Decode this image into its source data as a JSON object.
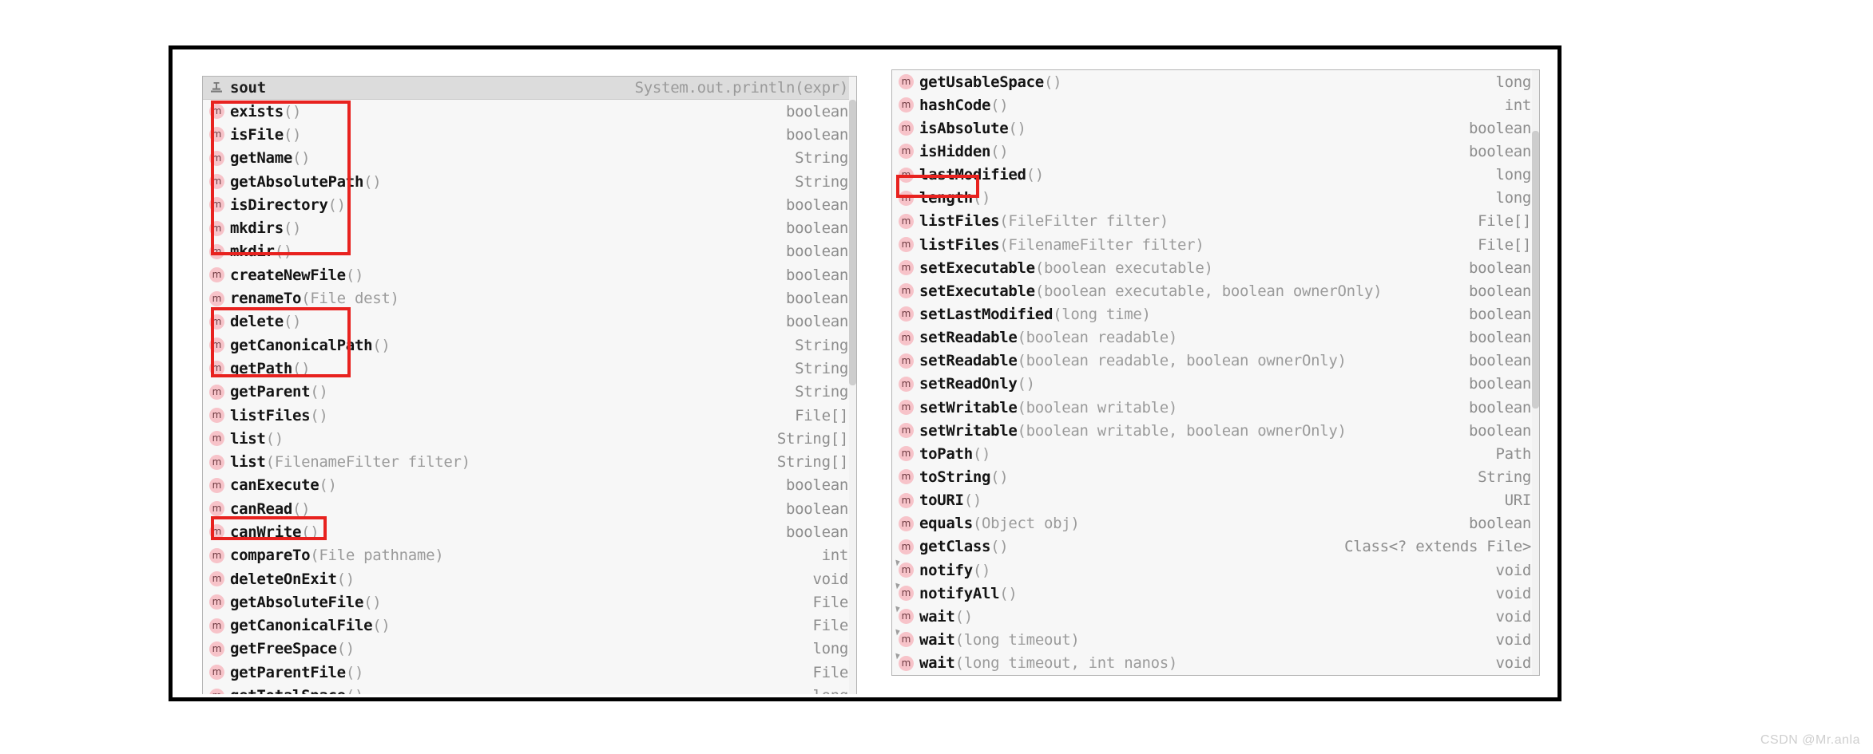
{
  "watermark": "CSDN @Mr.anla",
  "left_popup": {
    "template_header": {
      "icon": "live-template-stamp-icon",
      "name": "sout",
      "expansion": "System.out.println(expr)"
    },
    "scrollbar": {
      "present": true,
      "thumb_top_pct": 0,
      "thumb_height_pct": 48
    },
    "items": [
      {
        "icon": "method-icon",
        "name": "exists",
        "params": "()",
        "type": "boolean"
      },
      {
        "icon": "method-icon",
        "name": "isFile",
        "params": "()",
        "type": "boolean"
      },
      {
        "icon": "method-icon",
        "name": "getName",
        "params": "()",
        "type": "String"
      },
      {
        "icon": "method-icon",
        "name": "getAbsolutePath",
        "params": "()",
        "type": "String"
      },
      {
        "icon": "method-icon",
        "name": "isDirectory",
        "params": "()",
        "type": "boolean"
      },
      {
        "icon": "method-icon",
        "name": "mkdirs",
        "params": "()",
        "type": "boolean"
      },
      {
        "icon": "method-icon",
        "name": "mkdir",
        "params": "()",
        "type": "boolean"
      },
      {
        "icon": "method-icon",
        "name": "createNewFile",
        "params": "()",
        "type": "boolean"
      },
      {
        "icon": "method-icon",
        "name": "renameTo",
        "params": "(File dest)",
        "type": "boolean"
      },
      {
        "icon": "method-icon",
        "name": "delete",
        "params": "()",
        "type": "boolean"
      },
      {
        "icon": "method-icon",
        "name": "getCanonicalPath",
        "params": "()",
        "type": "String"
      },
      {
        "icon": "method-icon",
        "name": "getPath",
        "params": "()",
        "type": "String"
      },
      {
        "icon": "method-icon",
        "name": "getParent",
        "params": "()",
        "type": "String"
      },
      {
        "icon": "method-icon",
        "name": "listFiles",
        "params": "()",
        "type": "File[]"
      },
      {
        "icon": "method-icon",
        "name": "list",
        "params": "()",
        "type": "String[]"
      },
      {
        "icon": "method-icon",
        "name": "list",
        "params": "(FilenameFilter filter)",
        "type": "String[]"
      },
      {
        "icon": "method-icon",
        "name": "canExecute",
        "params": "()",
        "type": "boolean"
      },
      {
        "icon": "method-icon",
        "name": "canRead",
        "params": "()",
        "type": "boolean"
      },
      {
        "icon": "method-icon",
        "name": "canWrite",
        "params": "()",
        "type": "boolean"
      },
      {
        "icon": "method-icon",
        "name": "compareTo",
        "params": "(File pathname)",
        "type": "int"
      },
      {
        "icon": "method-icon",
        "name": "deleteOnExit",
        "params": "()",
        "type": "void"
      },
      {
        "icon": "method-icon",
        "name": "getAbsoluteFile",
        "params": "()",
        "type": "File"
      },
      {
        "icon": "method-icon",
        "name": "getCanonicalFile",
        "params": "()",
        "type": "File"
      },
      {
        "icon": "method-icon",
        "name": "getFreeSpace",
        "params": "()",
        "type": "long"
      },
      {
        "icon": "method-icon",
        "name": "getParentFile",
        "params": "()",
        "type": "File"
      },
      {
        "icon": "method-icon",
        "name": "getTotalSpace",
        "params": "()",
        "type": "long"
      }
    ],
    "highlights": [
      {
        "label": "exists-to-delete-group",
        "first_item": 0,
        "last_item": 9
      },
      {
        "label": "getPath-to-list-group",
        "first_item": 11,
        "last_item": 14
      },
      {
        "label": "deleteOnExit-item",
        "first_item": 20,
        "last_item": 20
      }
    ]
  },
  "right_popup": {
    "scrollbar": {
      "present": true,
      "thumb_top_pct": 10,
      "thumb_height_pct": 46
    },
    "items": [
      {
        "icon": "method-icon",
        "name": "getUsableSpace",
        "params": "()",
        "type": "long"
      },
      {
        "icon": "method-icon",
        "name": "hashCode",
        "params": "()",
        "type": "int"
      },
      {
        "icon": "method-icon",
        "name": "isAbsolute",
        "params": "()",
        "type": "boolean"
      },
      {
        "icon": "method-icon",
        "name": "isHidden",
        "params": "()",
        "type": "boolean"
      },
      {
        "icon": "method-icon",
        "name": "lastModified",
        "params": "()",
        "type": "long"
      },
      {
        "icon": "method-icon",
        "name": "length",
        "params": "()",
        "type": "long"
      },
      {
        "icon": "method-icon",
        "name": "listFiles",
        "params": "(FileFilter filter)",
        "type": "File[]"
      },
      {
        "icon": "method-icon",
        "name": "listFiles",
        "params": "(FilenameFilter filter)",
        "type": "File[]"
      },
      {
        "icon": "method-icon",
        "name": "setExecutable",
        "params": "(boolean executable)",
        "type": "boolean"
      },
      {
        "icon": "method-icon",
        "name": "setExecutable",
        "params": "(boolean executable, boolean ownerOnly)",
        "type": "boolean"
      },
      {
        "icon": "method-icon",
        "name": "setLastModified",
        "params": "(long time)",
        "type": "boolean"
      },
      {
        "icon": "method-icon",
        "name": "setReadable",
        "params": "(boolean readable)",
        "type": "boolean"
      },
      {
        "icon": "method-icon",
        "name": "setReadable",
        "params": "(boolean readable, boolean ownerOnly)",
        "type": "boolean"
      },
      {
        "icon": "method-icon",
        "name": "setReadOnly",
        "params": "()",
        "type": "boolean"
      },
      {
        "icon": "method-icon",
        "name": "setWritable",
        "params": "(boolean writable)",
        "type": "boolean"
      },
      {
        "icon": "method-icon",
        "name": "setWritable",
        "params": "(boolean writable, boolean ownerOnly)",
        "type": "boolean"
      },
      {
        "icon": "method-icon",
        "name": "toPath",
        "params": "()",
        "type": "Path"
      },
      {
        "icon": "method-icon",
        "name": "toString",
        "params": "()",
        "type": "String"
      },
      {
        "icon": "method-icon",
        "name": "toURI",
        "params": "()",
        "type": "URI"
      },
      {
        "icon": "method-icon",
        "name": "equals",
        "params": "(Object obj)",
        "type": "boolean"
      },
      {
        "icon": "method-icon",
        "name": "getClass",
        "params": "()",
        "type": "Class<? extends File>"
      },
      {
        "icon": "method-inherited-icon",
        "name": "notify",
        "params": "()",
        "type": "void"
      },
      {
        "icon": "method-inherited-icon",
        "name": "notifyAll",
        "params": "()",
        "type": "void"
      },
      {
        "icon": "method-inherited-icon",
        "name": "wait",
        "params": "()",
        "type": "void"
      },
      {
        "icon": "method-inherited-icon",
        "name": "wait",
        "params": "(long timeout)",
        "type": "void"
      },
      {
        "icon": "method-inherited-icon",
        "name": "wait",
        "params": "(long timeout, int nanos)",
        "type": "void"
      }
    ],
    "highlights": [
      {
        "label": "length-item",
        "first_item": 5,
        "last_item": 5
      }
    ]
  },
  "colors": {
    "highlight_red": "#e8221f",
    "frame_black": "#000000",
    "popup_bg": "#f7f7f7",
    "header_bg": "#dcdcdc",
    "icon_pink": "#f7c3c9",
    "method_name": "#141414",
    "param_gray": "#9b9b9b",
    "type_gray": "#8d8d8d"
  }
}
